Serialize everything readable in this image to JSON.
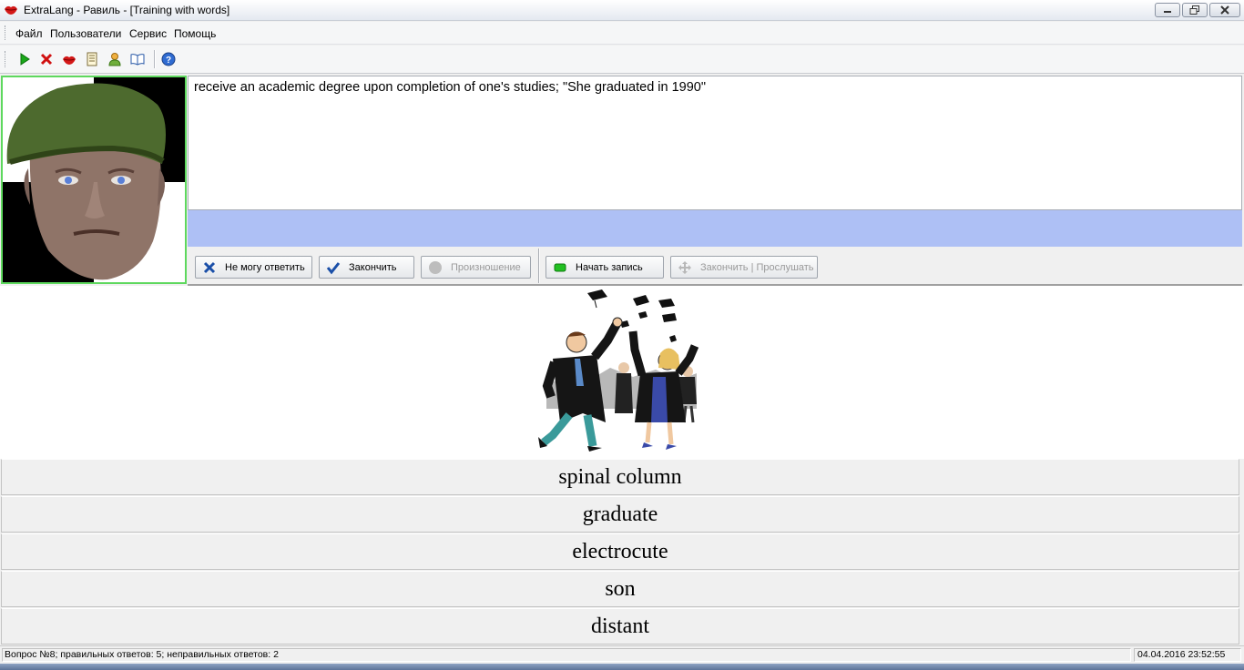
{
  "window": {
    "title": "ExtraLang - Равиль - [Training with words]"
  },
  "menu": {
    "items": [
      "Файл",
      "Пользователи",
      "Сервис",
      "Помощь"
    ]
  },
  "toolbar": {
    "icons": [
      "play-icon",
      "stop-icon",
      "lips-icon",
      "notebook-icon",
      "user-icon",
      "dictionary-icon",
      "help-icon"
    ]
  },
  "definition": {
    "text": "receive an academic degree upon completion of one's studies; \"She graduated in 1990\""
  },
  "buttons": {
    "cant_answer": "Не могу ответить",
    "finish": "Закончить",
    "pronunciation": "Произношение",
    "start_recording": "Начать запись",
    "finish_listen": "Закончить | Прослушать"
  },
  "choices": [
    "spinal column",
    "graduate",
    "electrocute",
    "son",
    "distant"
  ],
  "status": {
    "left": "Вопрос №8; правильных ответов: 5; неправильных ответов: 2",
    "right": "04.04.2016 23:52:55"
  },
  "colors": {
    "answer_strip": "#aec0f5",
    "avatar_border": "#5ed85e",
    "ok_green": "#1aa81a",
    "cancel_red": "#d01010"
  }
}
